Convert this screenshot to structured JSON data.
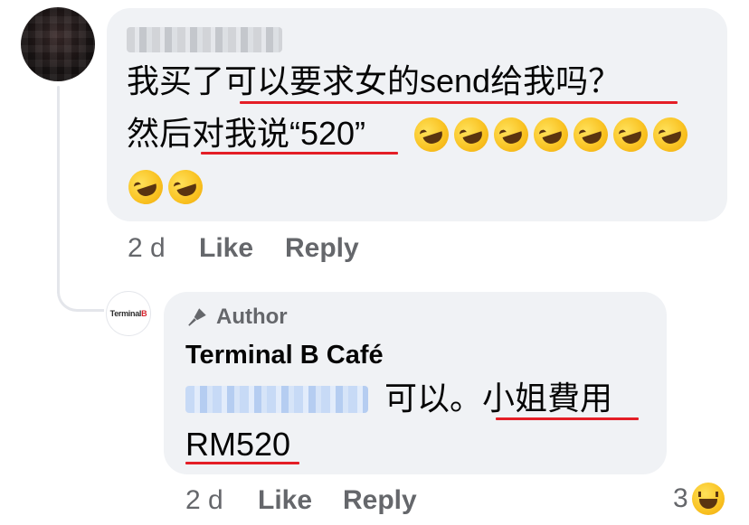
{
  "comment": {
    "author_blurred": true,
    "line1": "我买了可以要求女的send给我吗？",
    "line2": "然后对我说“520”",
    "emoji_name": "rolling-on-the-floor-laughing",
    "emoji_count": 9,
    "time": "2 d",
    "like": "Like",
    "reply": "Reply"
  },
  "reply_comment": {
    "avatar_text_a": "Terminal",
    "avatar_text_b": "B",
    "badge": "Author",
    "page_name": "Terminal B Café",
    "mention_blurred": true,
    "text_line1": "可以。小姐費用",
    "text_line2": "RM520",
    "time": "2 d",
    "like": "Like",
    "reply": "Reply",
    "reaction_count": "3",
    "reaction_icon": "haha-icon"
  },
  "colors": {
    "bubble": "#f0f2f5",
    "meta": "#65676b",
    "underline": "#e41e26"
  }
}
